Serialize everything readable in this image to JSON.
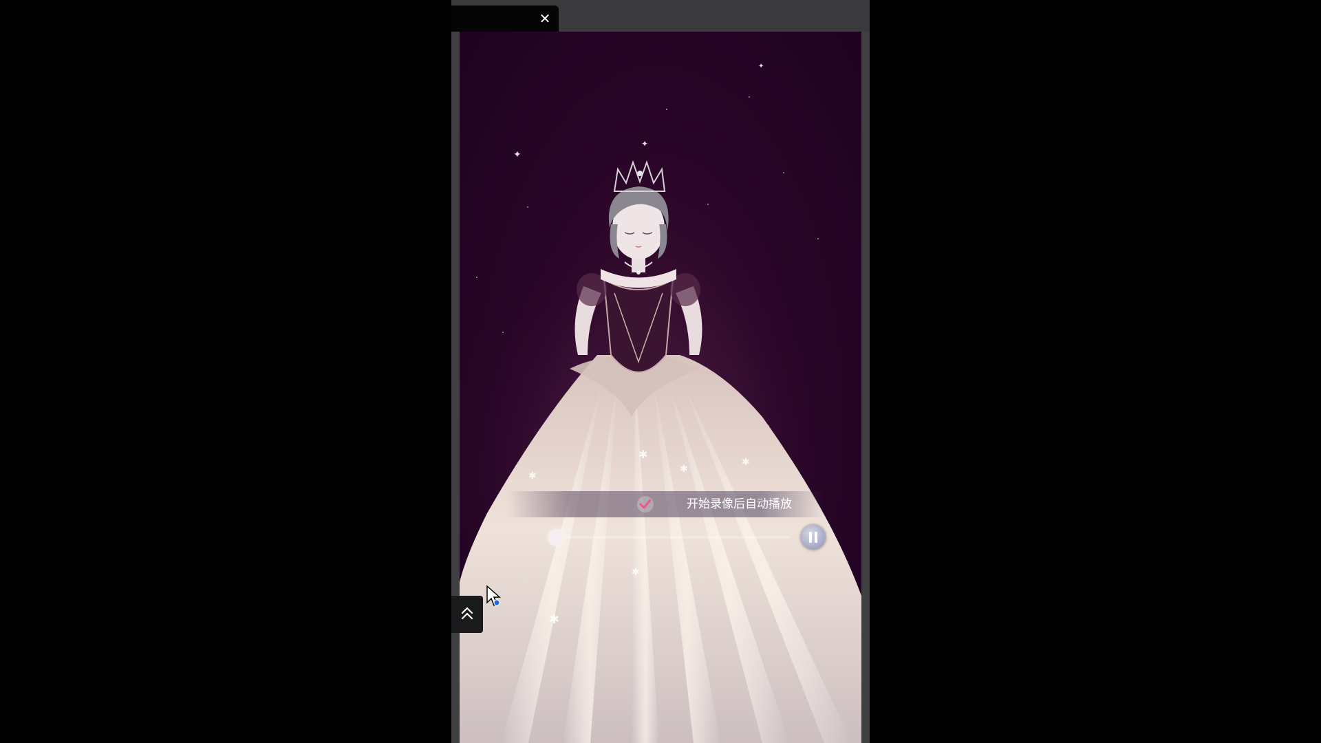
{
  "tab": {
    "title": "",
    "close_icon": "close-icon"
  },
  "overlay": {
    "record_autoplay_label": "开始录像后自动播放",
    "record_autoplay_checked": true,
    "progress_fraction": 0.0,
    "playback_state": "paused-icon"
  },
  "controls": {
    "collapse_icon": "double-chevron-up-icon"
  },
  "colors": {
    "scene_background": "#2a0628",
    "check_accent": "#e85a8a",
    "gown": "#efe2da"
  }
}
